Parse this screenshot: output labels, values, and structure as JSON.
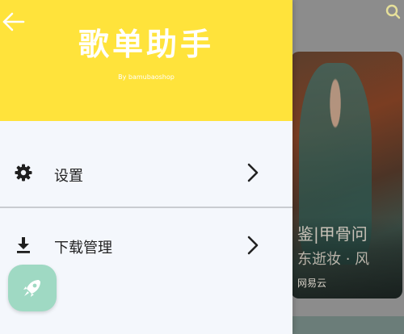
{
  "drawer": {
    "title": "歌单助手",
    "subtitle": "By bamubaoshop",
    "menu": [
      {
        "label": "设置",
        "icon": "gear-icon"
      },
      {
        "label": "下载管理",
        "icon": "download-icon"
      }
    ],
    "header_color": "#ffe33b",
    "fab_color": "#9fd9c3"
  },
  "background": {
    "card_title": "鉴|甲骨问",
    "card_title_line2": "东逝妆 · 风",
    "card_author": "网易云"
  }
}
